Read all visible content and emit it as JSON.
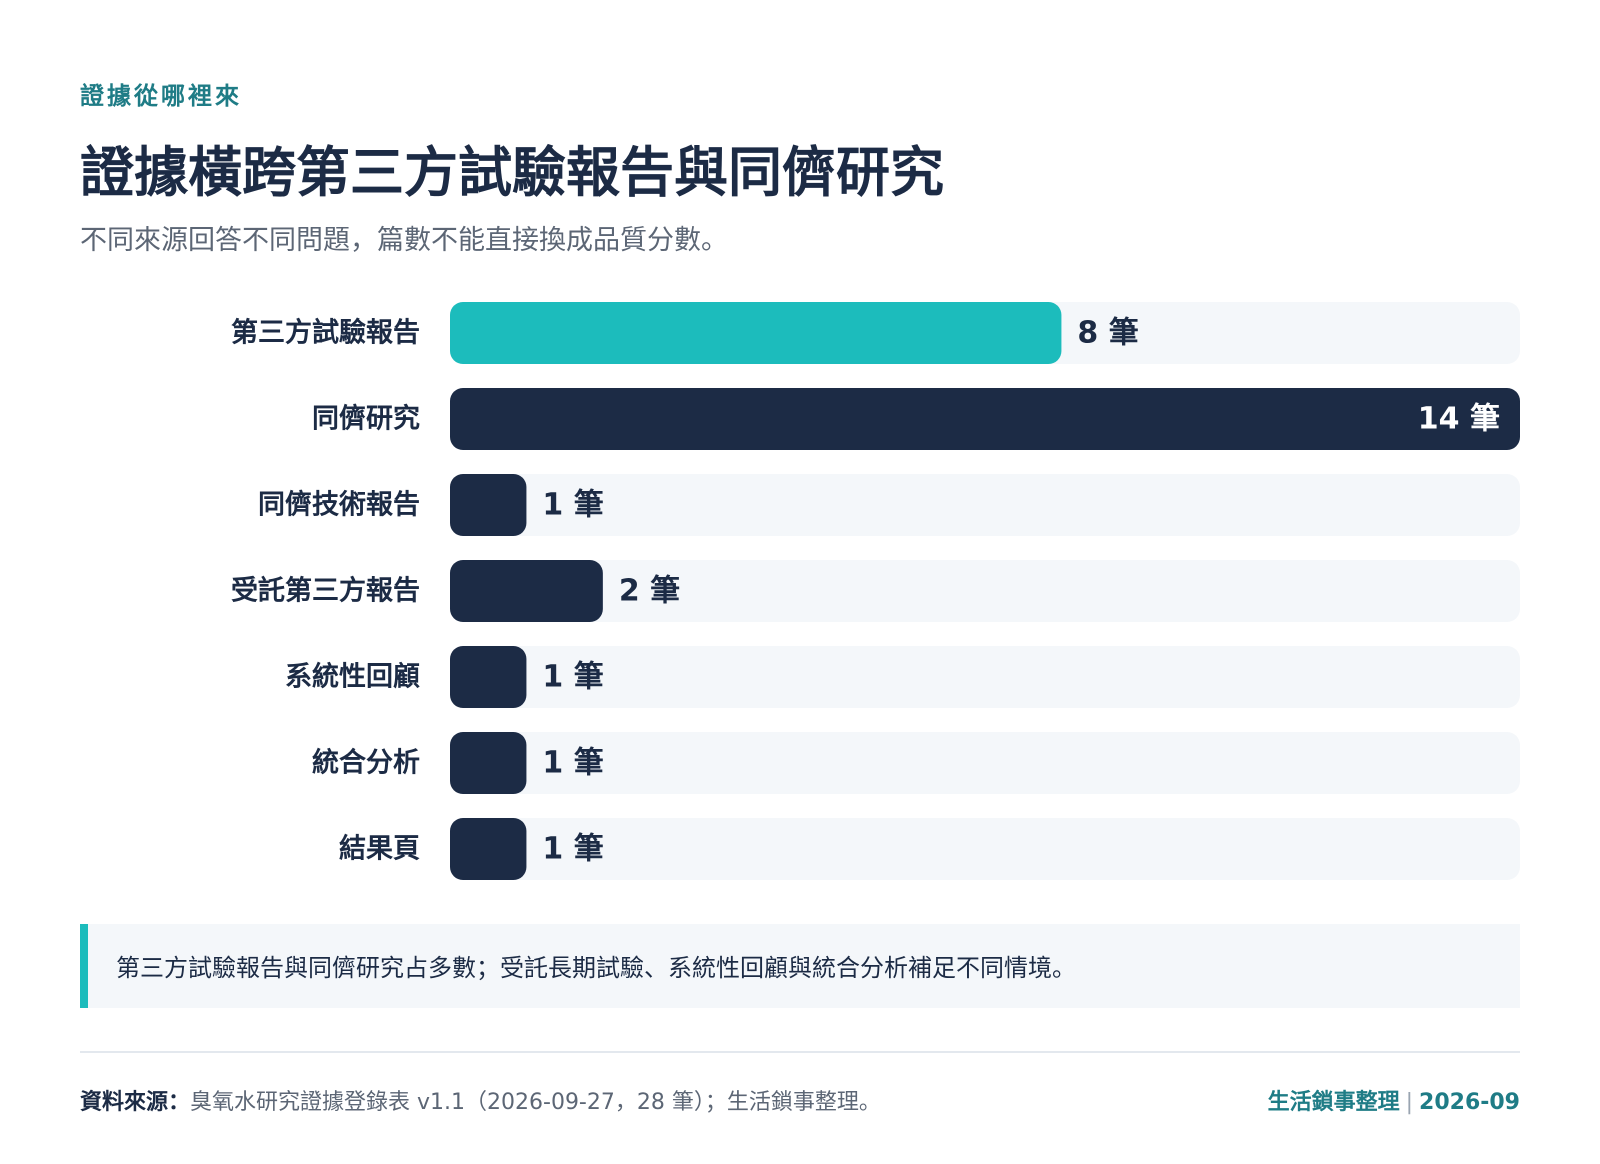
{
  "header": {
    "kicker": "證據從哪裡來",
    "title": "證據橫跨第三方試驗報告與同儕研究",
    "subtitle": "不同來源回答不同問題，篇數不能直接換成品質分數。"
  },
  "chart_data": {
    "type": "bar",
    "orientation": "horizontal",
    "categories": [
      "第三方試驗報告",
      "同儕研究",
      "同儕技術報告",
      "受託第三方報告",
      "系統性回顧",
      "統合分析",
      "結果頁"
    ],
    "values": [
      8,
      14,
      1,
      2,
      1,
      1,
      1
    ],
    "value_labels": [
      "8 筆",
      "14 筆",
      "1 筆",
      "2 筆",
      "1 筆",
      "1 筆",
      "1 筆"
    ],
    "unit": "筆",
    "xlim": [
      0,
      14
    ],
    "grid": false,
    "colors": [
      "#1cbcbc",
      "#1c2b45",
      "#1c2b45",
      "#1c2b45",
      "#1c2b45",
      "#1c2b45",
      "#1c2b45"
    ],
    "track_color": "#f4f7fa"
  },
  "note": {
    "text": "第三方試驗報告與同儕研究占多數；受託長期試驗、系統性回顧與統合分析補足不同情境。",
    "accent_color": "#1cbcbc"
  },
  "footer": {
    "source_label": "資料來源：",
    "source_text": "臭氧水研究證據登錄表 v1.1（2026-09-27，28 筆）；生活鎖事整理。",
    "brand": "生活鎖事整理",
    "separator": "|",
    "date": "2026-09"
  }
}
